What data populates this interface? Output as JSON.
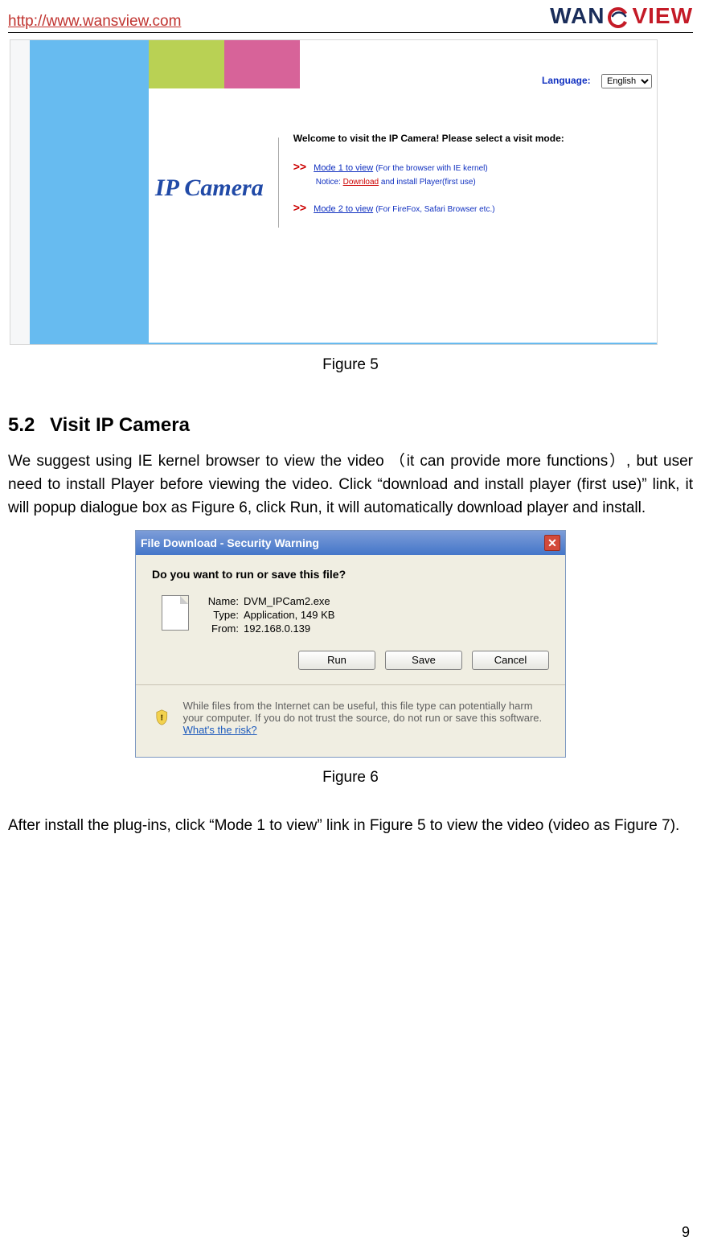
{
  "header": {
    "url": "http://www.wansview.com",
    "logo_text_1": "WAN",
    "logo_text_2": "VIEW"
  },
  "fig5": {
    "lang_label": "Language:",
    "lang_value": "English",
    "title": "IP Camera",
    "welcome": "Welcome to visit the IP Camera! Please select a visit mode:",
    "arrow": ">>",
    "mode1_link": "Mode 1 to view",
    "mode1_hint": "(For the browser with IE kernel)",
    "notice_prefix": "Notice:",
    "dl_link": "Download",
    "dl_rest": "and install Player(first use)",
    "mode2_link": "Mode 2 to view",
    "mode2_hint": "(For FireFox, Safari Browser etc.)",
    "caption": "Figure 5"
  },
  "section": {
    "num": "5.2",
    "title": "Visit IP Camera",
    "para1": "We suggest using IE kernel browser to view the video  （it can provide more functions）, but user need to install Player before viewing the video. Click “download and install player (first use)” link, it will popup dialogue box as Figure 6, click Run, it will automatically download player and install."
  },
  "fig6": {
    "title": "File Download - Security Warning",
    "question": "Do you want to run or save this file?",
    "name_label": "Name:",
    "name_val": "DVM_IPCam2.exe",
    "type_label": "Type:",
    "type_val": "Application, 149 KB",
    "from_label": "From:",
    "from_val": "192.168.0.139",
    "run": "Run",
    "save": "Save",
    "cancel": "Cancel",
    "warn_text": "While files from the Internet can be useful, this file type can potentially harm your computer. If you do not trust the source, do not run or save this software. ",
    "warn_link": "What's the risk?",
    "caption": "Figure 6"
  },
  "after": {
    "para": "After install the plug-ins, click “Mode 1 to view” link in Figure 5 to view the video (video as Figure 7)."
  },
  "page_number": "9"
}
